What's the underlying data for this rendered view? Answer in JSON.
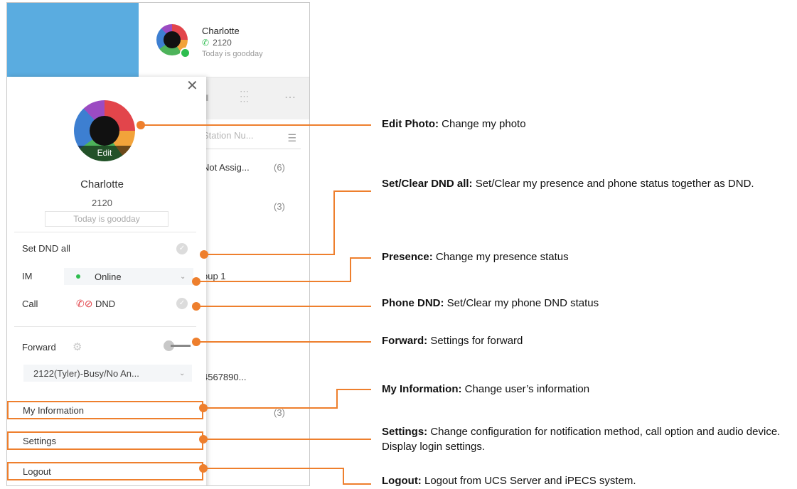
{
  "header": {
    "name": "Charlotte",
    "extension": "2120",
    "status_message": "Today is goodday"
  },
  "contact_list": {
    "search_placeholder": "Station Nu...",
    "rows": [
      {
        "label": "Not Assig...",
        "count": "(6)"
      },
      {
        "label": "",
        "count": "(3)"
      },
      {
        "label": "oup 1",
        "count": ""
      },
      {
        "label": "4567890...",
        "count": ""
      },
      {
        "label": "",
        "count": "(3)"
      }
    ]
  },
  "profile_panel": {
    "edit_label": "Edit",
    "name": "Charlotte",
    "extension": "2120",
    "status_message": "Today is goodday",
    "set_dnd_all_label": "Set DND all",
    "im_label": "IM",
    "im_value": "Online",
    "call_label": "Call",
    "call_value": "DND",
    "forward_label": "Forward",
    "forward_value": "2122(Tyler)-Busy/No An...",
    "menu": {
      "my_information": "My Information",
      "settings": "Settings",
      "logout": "Logout"
    }
  },
  "annotations": [
    {
      "title": "Edit Photo:",
      "text": " Change my photo"
    },
    {
      "title": "Set/Clear DND all:",
      "text": " Set/Clear my presence and phone status together as DND."
    },
    {
      "title": "Presence:",
      "text": " Change my presence status"
    },
    {
      "title": "Phone DND:",
      "text": " Set/Clear my phone DND status"
    },
    {
      "title": "Forward:",
      "text": " Settings for forward"
    },
    {
      "title": "My Information:",
      "text": " Change user’s information"
    },
    {
      "title": "Settings:",
      "text": " Change configuration for notification method, call option and audio device. Display login settings."
    },
    {
      "title": "Logout:",
      "text": " Logout from UCS Server and iPECS system."
    }
  ],
  "colors": {
    "accent": "#ee7f2d",
    "online": "#2ebd4f",
    "titlebar": "#5aace0"
  }
}
